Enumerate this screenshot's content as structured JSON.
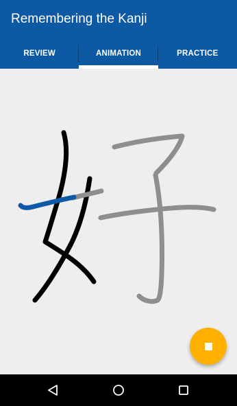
{
  "app_bar": {
    "title": "Remembering the Kanji",
    "background_color": "#0d59a3"
  },
  "tabs": [
    {
      "label": "REVIEW",
      "selected": false
    },
    {
      "label": "ANIMATION",
      "selected": true
    },
    {
      "label": "PRACTICE",
      "selected": false
    }
  ],
  "kanji": {
    "character": "好",
    "completed_stroke_color": "#000000",
    "active_stroke_color": "#0f5aa6",
    "pending_stroke_color": "#8e8e8e",
    "canvas_background": "#eeeeee"
  },
  "fab": {
    "icon": "stop-icon",
    "color": "#ffb000"
  },
  "nav_bar": {
    "buttons": [
      "back-icon",
      "home-icon",
      "recents-icon"
    ]
  }
}
